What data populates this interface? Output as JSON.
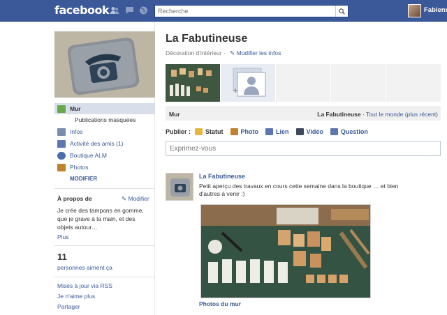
{
  "topbar": {
    "logo": "facebook",
    "search_placeholder": "Recherche",
    "user_name": "Fabienn"
  },
  "left": {
    "nav": [
      {
        "label": "Mur",
        "icon": "wall-icon"
      },
      {
        "label": "Publications masquées",
        "icon": ""
      },
      {
        "label": "Infos",
        "icon": "info-icon"
      },
      {
        "label": "Activité des amis (1)",
        "icon": "friends-icon"
      },
      {
        "label": "Boutique ALM",
        "icon": "shop-icon"
      },
      {
        "label": "Photos",
        "icon": "photos-icon"
      }
    ],
    "modifier_label": "MODIFIER",
    "about_title": "À propos de",
    "about_edit": "Modifier",
    "about_text": "Je crée des tampons en gomme, que je grave à la main, et des objets autour…",
    "about_more": "Plus",
    "likes_count": "11",
    "likes_label": "personnes aiment ça",
    "links": [
      "Mises à jour via RSS",
      "Je n'aime plus",
      "Partager"
    ]
  },
  "main": {
    "page_title": "La Fabutineuse",
    "category": "Décoration d'intérieur",
    "edit_info": "Modifier les infos",
    "wall_label": "Mur",
    "filter_name": "La Fabutineuse",
    "filter_sep": " · ",
    "filter_all": "Tout le monde (plus récent)",
    "publish_label": "Publier :",
    "publish_options": [
      "Statut",
      "Photo",
      "Lien",
      "Vidéo",
      "Question"
    ],
    "compose_placeholder": "Exprimez-vous",
    "post": {
      "author": "La Fabutineuse",
      "text": "Petit aperçu des travaux en cours cette semaine dans la boutique … et bien d'autres à venir :)",
      "caption": "Photos du mur"
    }
  },
  "colors": {
    "brand": "#3b5998",
    "nav_active": "#d8dfea",
    "link": "#3b5998"
  }
}
